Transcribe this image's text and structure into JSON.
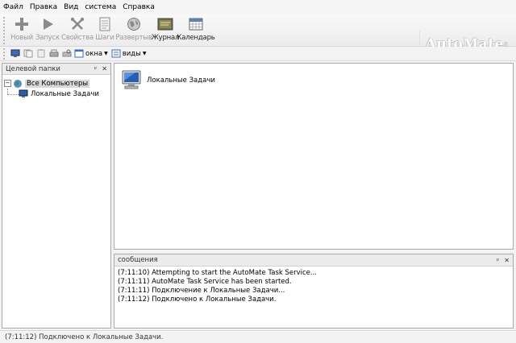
{
  "menu": [
    "Файл",
    "Правка",
    "Вид",
    "система",
    "Справка"
  ],
  "toolbar": {
    "buttons": [
      {
        "label": "Новый",
        "icon": "plus-icon",
        "enabled": false
      },
      {
        "label": "Запуск",
        "icon": "play-icon",
        "enabled": false
      },
      {
        "label": "Свойства",
        "icon": "wrench-icon",
        "enabled": false
      },
      {
        "label": "Шаги",
        "icon": "document-icon",
        "enabled": false
      },
      {
        "label": "Развертыв",
        "icon": "globe-icon",
        "enabled": false
      },
      {
        "label": "Журнал",
        "icon": "journal-icon",
        "enabled": true
      },
      {
        "label": "Календарь",
        "icon": "calendar-icon",
        "enabled": true
      }
    ],
    "brand": "AutoMate",
    "brand_version": "8"
  },
  "toolbar2": {
    "windows_label": "окна",
    "views_label": "виды"
  },
  "left_panel": {
    "title": "Целевой папки",
    "tree": {
      "root_label": "Все Компьютеры",
      "child_label": "Локальные Задачи"
    }
  },
  "main_panel": {
    "item_label": "Локальные Задачи"
  },
  "messages": {
    "title": "сообщения",
    "lines": [
      "(7:11:10) Attempting to start the AutoMate Task Service...",
      "(7:11:11) AutoMate Task Service has been started.",
      "(7:11:11) Подключение к Локальные Задачи...",
      "(7:11:12) Подключено к Локальные Задачи."
    ]
  },
  "status": {
    "text": "(7:11:12) Подключено к Локальные Задачи."
  },
  "colors": {
    "accent_blue": "#2a5fb0",
    "disabled_text": "#9a9a9a",
    "panel_border": "#a9a9a9"
  }
}
